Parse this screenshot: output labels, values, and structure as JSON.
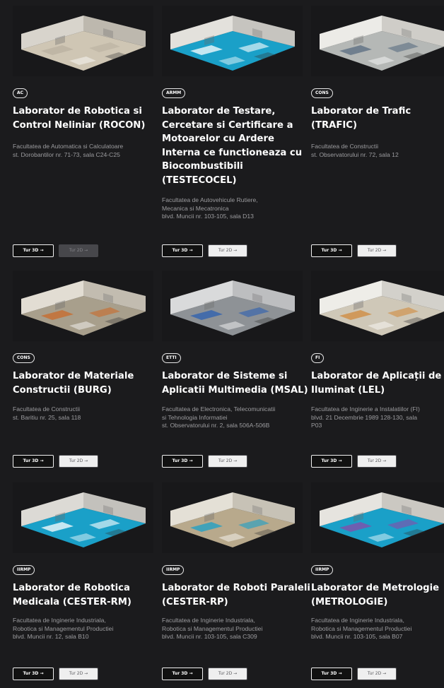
{
  "labs": [
    {
      "badge": "AC",
      "title_lines": [
        "Laborator de Robotica si",
        "Control Neliniar (ROCON)"
      ],
      "desc_lines": [
        "Facultatea de Automatica si Calculatoare",
        "st. Dorobantilor nr. 71-73, sala C24-C25"
      ],
      "btn3d": "Tur 3D →",
      "btn2d": "Tur 2D →"
    },
    {
      "badge": "ARMM",
      "title_lines": [
        "Laborator de Testare,",
        "Cercetare si Certificare a",
        "Motoarelor cu Ardere",
        "Interna ce functioneaza cu",
        "Biocombustibili",
        "(TESTECOCEL)"
      ],
      "desc_lines": [
        "Facultatea de Autovehicule Rutiere,",
        "Mecanica si Mecatronica",
        "blvd. Muncii nr. 103-105, sala D13"
      ],
      "btn3d": "Tur 3D →",
      "btn2d": "Tur 2D →"
    },
    {
      "badge": "CONS",
      "title_lines": [
        "Laborator de Trafic",
        "(TRAFIC)"
      ],
      "desc_lines": [
        "Facultatea de Constructii",
        "st. Observatorului nr. 72, sala 12"
      ],
      "btn3d": "Tur 3D →",
      "btn2d": "Tur 2D →"
    },
    {
      "badge": "CONS",
      "title_lines": [
        "Laborator de Materiale",
        "Constructii (BURG)"
      ],
      "desc_lines": [
        "Facultatea de Constructii",
        "st. Baritiu nr. 25, sala 118"
      ],
      "btn3d": "Tur 3D →",
      "btn2d": "Tur 2D →"
    },
    {
      "badge": "ETTI",
      "title_lines": [
        "Laborator de Sisteme si",
        "Aplicatii Multimedia (MSAL)"
      ],
      "desc_lines": [
        "Facultatea de Electronica, Telecomunicatii",
        "si Tehnologia Informatiei",
        "st. Observatorului nr. 2, sala 506A-506B"
      ],
      "btn3d": "Tur 3D →",
      "btn2d": "Tur 2D →"
    },
    {
      "badge": "FI",
      "title_lines": [
        "Laborator de Aplicații de",
        "Iluminat (LEL)"
      ],
      "desc_lines": [
        "Facultatea de Inginerie a Instalatiilor (FI)",
        "blvd. 21 Decembrie 1989 128-130, sala",
        "P03"
      ],
      "btn3d": "Tur 3D →",
      "btn2d": "Tur 2D →"
    },
    {
      "badge": "IIRMP",
      "title_lines": [
        "Laborator de Robotica",
        "Medicala (CESTER-RM)"
      ],
      "desc_lines": [
        "Facultatea de Inginerie Industriala,",
        "Robotica si Managementul Productiei",
        "blvd. Muncii nr. 12, sala B10"
      ],
      "btn3d": "Tur 3D →",
      "btn2d": "Tur 2D →"
    },
    {
      "badge": "IIRMP",
      "title_lines": [
        "Laborator de Roboti Paraleli",
        "(CESTER-RP)"
      ],
      "desc_lines": [
        "Facultatea de Inginerie Industriala,",
        "Robotica si Managementul Productiei",
        "blvd. Muncii nr. 103-105, sala C309"
      ],
      "btn3d": "Tur 3D →",
      "btn2d": "Tur 2D →"
    },
    {
      "badge": "IIRMP",
      "title_lines": [
        "Laborator de Metrologie",
        "(METROLOGIE)"
      ],
      "desc_lines": [
        "Facultatea de Inginerie Industriala,",
        "Robotica si Managementul Productiei",
        "blvd. Muncii nr. 103-105, sala B07"
      ],
      "btn3d": "Tur 3D →",
      "btn2d": "Tur 2D →"
    }
  ],
  "colors": {
    "background": "#1b1b1d",
    "text": "#ffffff",
    "muted": "#9c9c9f",
    "floor_accent": "#1aa0c8"
  }
}
